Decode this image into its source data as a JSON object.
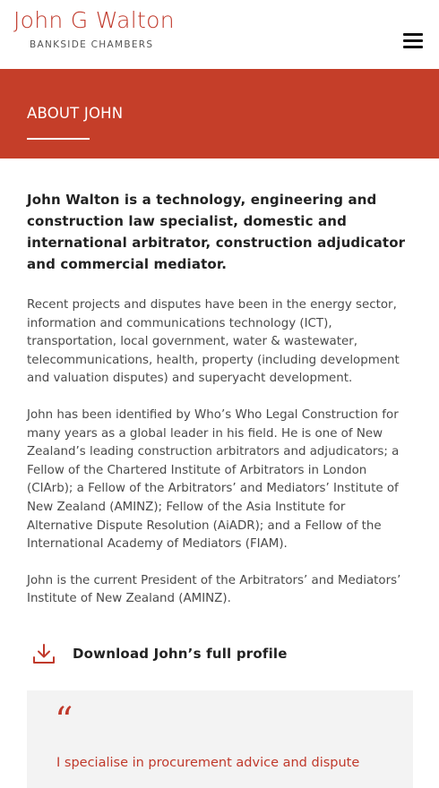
{
  "header": {
    "brand_name": "John G Walton",
    "brand_sub": "BANKSIDE CHAMBERS",
    "menu_icon": "hamburger-menu-icon"
  },
  "banner": {
    "title": "ABOUT JOHN",
    "background_color": "#c53e29"
  },
  "content": {
    "lead": "John Walton is a technology, engineering and construction law specialist, domestic and international arbitrator, construction adjudicator and commercial mediator.",
    "paragraphs": [
      "Recent projects and disputes have been in the energy sector, information and communications technology (ICT), transportation, local government, water & wastewater, telecommunications, health, property (including development and valuation disputes) and superyacht development.",
      "John has been identified by Who’s Who Legal Construction for many years as a global leader in his field.  He is one of New Zealand’s leading construction arbitrators and adjudicators; a Fellow of the Chartered Institute of Arbitrators in London (CIArb); a Fellow of the Arbitrators’ and Mediators’ Institute of New Zealand (AMINZ); Fellow of the Asia Institute for Alternative Dispute Resolution (AiADR); and a Fellow of the International Academy of Mediators (FIAM).",
      "John is the current President of the Arbitrators’ and Mediators’ Institute of New Zealand (AMINZ)."
    ]
  },
  "download": {
    "label": "Download John’s full profile",
    "icon": "download-icon"
  },
  "quote": {
    "mark": "“",
    "text": "I specialise in procurement advice and dispute"
  },
  "colors": {
    "accent": "#c0392b",
    "quote_bg": "#f3f3f3"
  }
}
